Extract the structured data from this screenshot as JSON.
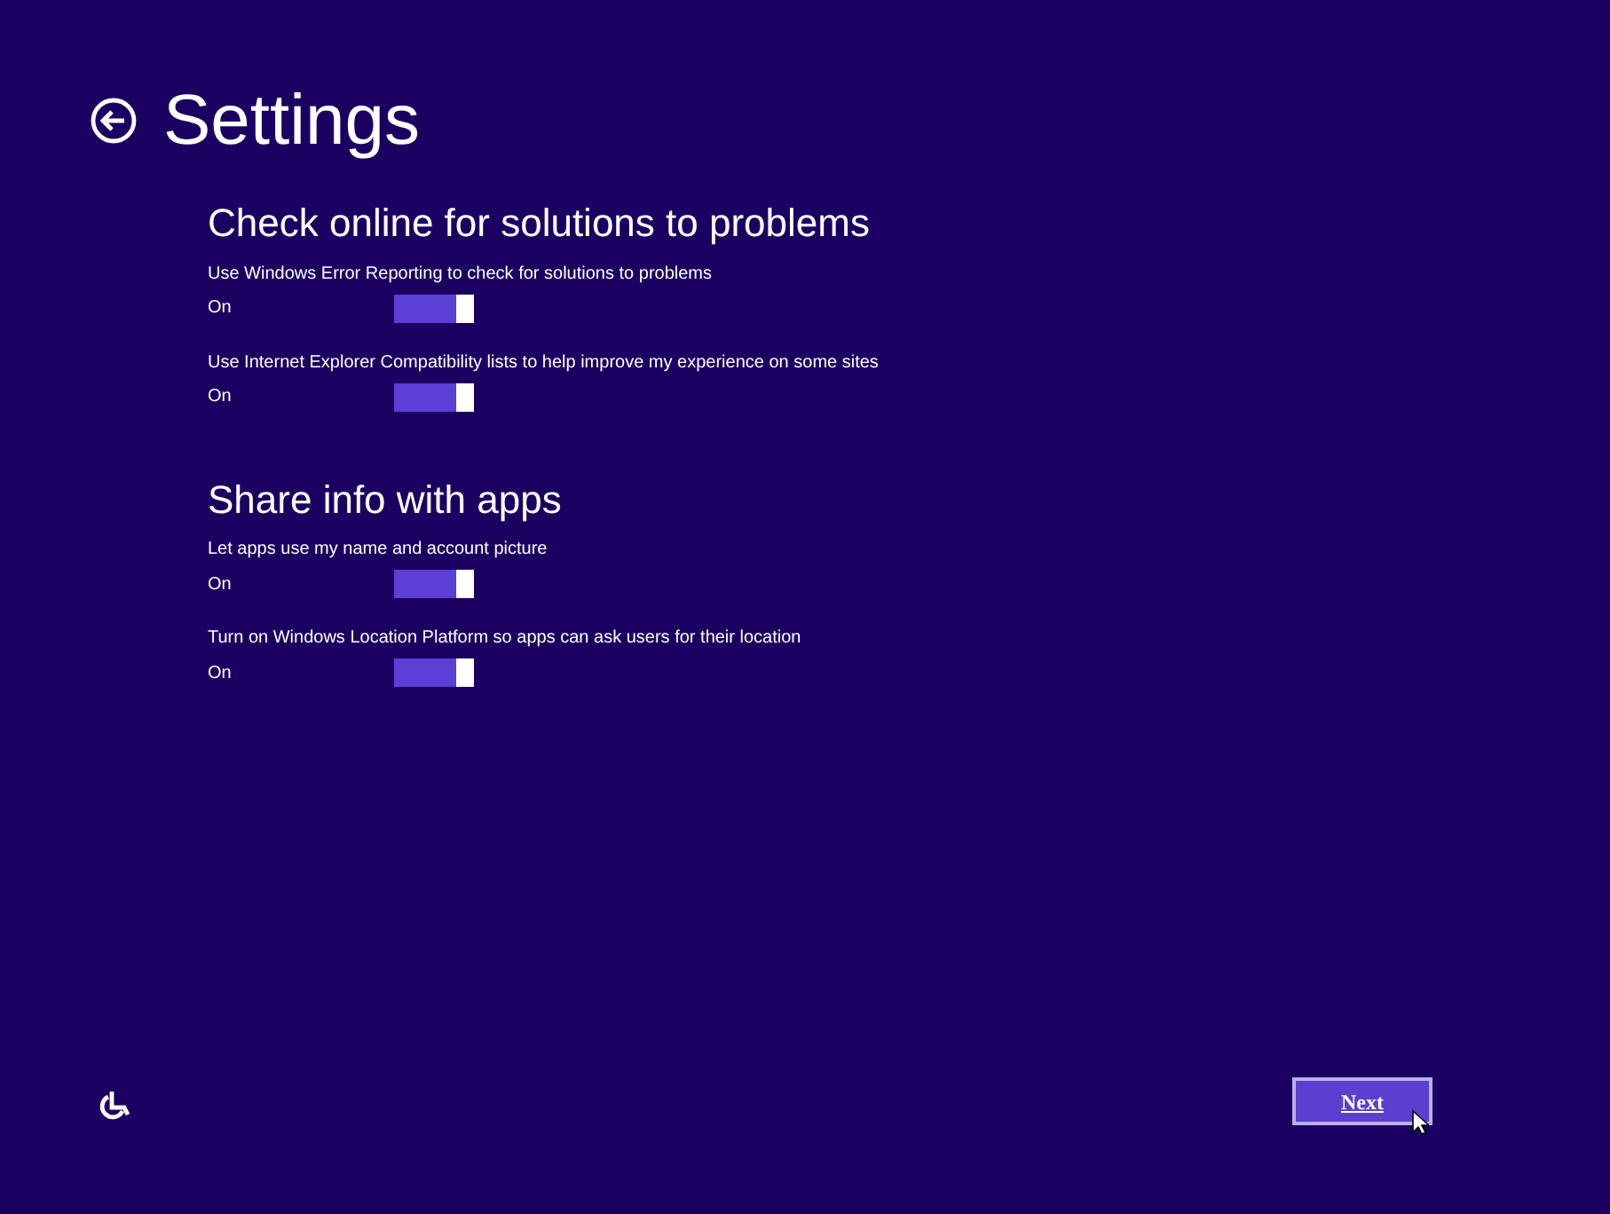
{
  "title": "Settings",
  "sections": [
    {
      "heading": "Check online for solutions to problems",
      "settings": [
        {
          "label": "Use Windows Error Reporting to check for solutions to problems",
          "state_text": "On",
          "on": true
        },
        {
          "label": "Use Internet Explorer Compatibility lists to help improve my experience on some sites",
          "state_text": "On",
          "on": true
        }
      ]
    },
    {
      "heading": "Share info with apps",
      "settings": [
        {
          "label": "Let apps use my name and account picture",
          "state_text": "On",
          "on": true
        },
        {
          "label": "Turn on Windows Location Platform so apps can ask users for their location",
          "state_text": "On",
          "on": true
        }
      ]
    }
  ],
  "next_button": "Next"
}
